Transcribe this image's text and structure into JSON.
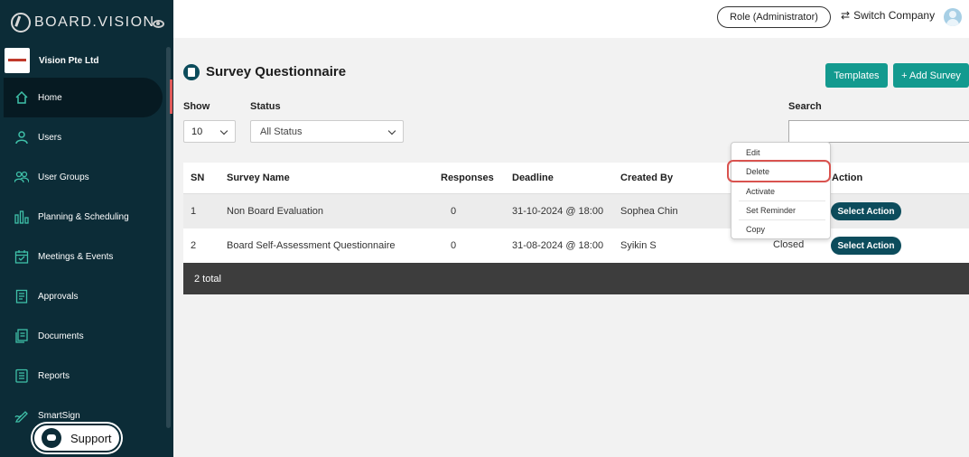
{
  "brand": {
    "logo_text": "BOARD.VISION",
    "company_name": "Vision Pte Ltd"
  },
  "sidebar": {
    "items": [
      {
        "label": "Home",
        "icon": "home-icon"
      },
      {
        "label": "Users",
        "icon": "user-icon"
      },
      {
        "label": "User Groups",
        "icon": "user-groups-icon"
      },
      {
        "label": "Planning & Scheduling",
        "icon": "bar-chart-icon"
      },
      {
        "label": "Meetings & Events",
        "icon": "calendar-icon"
      },
      {
        "label": "Approvals",
        "icon": "clipboard-icon"
      },
      {
        "label": "Documents",
        "icon": "documents-icon"
      },
      {
        "label": "Reports",
        "icon": "report-icon"
      },
      {
        "label": "SmartSign",
        "icon": "pen-icon"
      }
    ],
    "support_label": "Support"
  },
  "topbar": {
    "role_label": "Role (Administrator)",
    "switch_company_label": "Switch Company"
  },
  "page": {
    "title": "Survey Questionnaire",
    "templates_label": "Templates",
    "add_survey_label": "+ Add Survey"
  },
  "filters": {
    "show_label": "Show",
    "show_value": "10",
    "status_label": "Status",
    "status_value": "All Status",
    "search_label": "Search"
  },
  "table": {
    "headers": [
      "SN",
      "Survey Name",
      "Responses",
      "Deadline",
      "Created By",
      "Action"
    ],
    "rows": [
      {
        "sn": "1",
        "name": "Non Board Evaluation",
        "responses": "0",
        "deadline": "31-10-2024 @ 18:00",
        "created_by": "Sophea Chin",
        "status": "",
        "action": "Select Action"
      },
      {
        "sn": "2",
        "name": "Board Self-Assessment Questionnaire",
        "responses": "0",
        "deadline": "31-08-2024 @ 18:00",
        "created_by": "Syikin S",
        "status": "Closed",
        "action": "Select Action"
      }
    ],
    "footer": "2 total"
  },
  "action_menu": {
    "items": [
      "Edit",
      "Delete",
      "Activate",
      "Set Reminder",
      "Copy"
    ],
    "highlighted": "Delete"
  },
  "colors": {
    "sidebar_bg": "#0c2c37",
    "accent_teal": "#139a8f",
    "action_button": "#0c4c5c",
    "highlight_red": "#d9534f"
  }
}
